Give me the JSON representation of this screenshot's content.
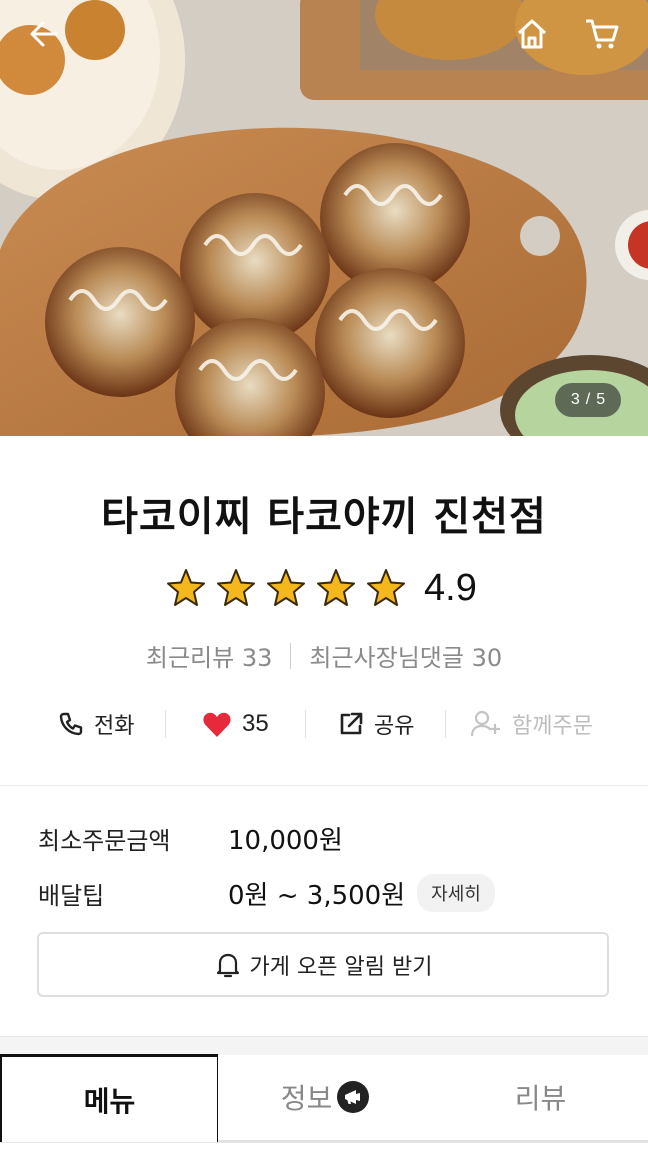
{
  "hero": {
    "image_counter": {
      "current": "3",
      "separator": "/",
      "total": "5"
    },
    "icons": {
      "back": "arrow-left-icon",
      "home": "home-icon",
      "cart": "shopping-cart-icon"
    }
  },
  "store": {
    "name": "타코이찌 타코야끼 진천점",
    "rating": "4.9",
    "stars": 5,
    "recent_reviews_label": "최근리뷰 33",
    "owner_replies_label": "최근사장님댓글 30"
  },
  "actions": {
    "phone_label": "전화",
    "like_count": "35",
    "share_label": "공유",
    "group_order_label": "함께주문"
  },
  "order_info": {
    "min_order_label": "최소주문금액",
    "min_order_value": "10,000원",
    "delivery_tip_label": "배달팁",
    "delivery_tip_value": "0원 ~ 3,500원",
    "detail_label": "자세히",
    "open_alarm_label": "가게 오픈 알림 받기"
  },
  "tabs": [
    {
      "label": "메뉴",
      "active": true
    },
    {
      "label": "정보",
      "active": false
    },
    {
      "label": "리뷰",
      "active": false
    }
  ],
  "colors": {
    "heart": "#e8293b",
    "star": "#f5b81c",
    "muted": "#8a8a8a"
  }
}
